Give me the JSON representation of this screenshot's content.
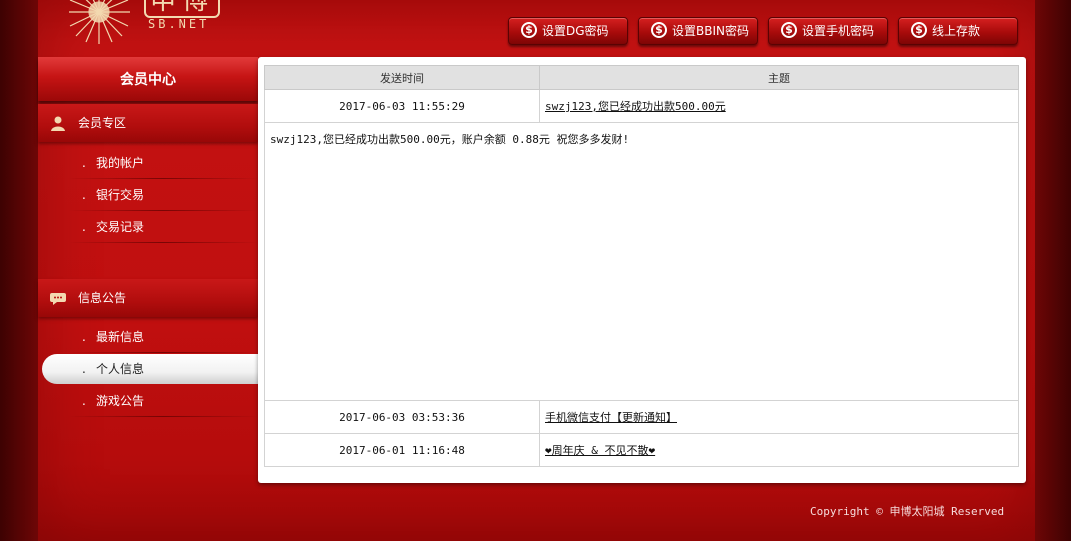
{
  "logo": {
    "cn": "申博",
    "en": "SB.NET"
  },
  "toolbar": {
    "buttons": [
      {
        "label": "设置DG密码",
        "icon": "dollar-coin-icon"
      },
      {
        "label": "设置BBIN密码",
        "icon": "dollar-coin-icon"
      },
      {
        "label": "设置手机密码",
        "icon": "dollar-coin-icon"
      },
      {
        "label": "线上存款",
        "icon": "dollar-coin-icon"
      }
    ],
    "coin_symbol": "$"
  },
  "sidebar": {
    "title": "会员中心",
    "sections": [
      {
        "label": "会员专区",
        "icon": "member-icon",
        "items": [
          {
            "label": "我的帐户"
          },
          {
            "label": "银行交易"
          },
          {
            "label": "交易记录"
          }
        ]
      },
      {
        "label": "信息公告",
        "icon": "chat-bubble-icon",
        "items": [
          {
            "label": "最新信息"
          },
          {
            "label": "个人信息",
            "active": true
          },
          {
            "label": "游戏公告"
          }
        ]
      }
    ],
    "bullet": "."
  },
  "messages": {
    "headers": {
      "time": "发送时间",
      "subject": "主题"
    },
    "rows": [
      {
        "time": "2017-06-03 11:55:29",
        "subject": "swzj123,您已经成功出款500.00元",
        "body": "swzj123,您已经成功出款500.00元，账户余额 0.88元 祝您多多发财!"
      },
      {
        "time": "2017-06-03 03:53:36",
        "subject": "手机微信支付【更新通知】"
      },
      {
        "time": "2017-06-01 11:16:48",
        "subject": "❤周年庆 & 不见不散❤"
      }
    ]
  },
  "footer": {
    "copyright": "Copyright © 申博太阳城 Reserved"
  },
  "colors": {
    "primary_red": "#c31212",
    "dark_red": "#5a0505",
    "panel": "#ffffff",
    "header_gray": "#e1e1e1"
  }
}
